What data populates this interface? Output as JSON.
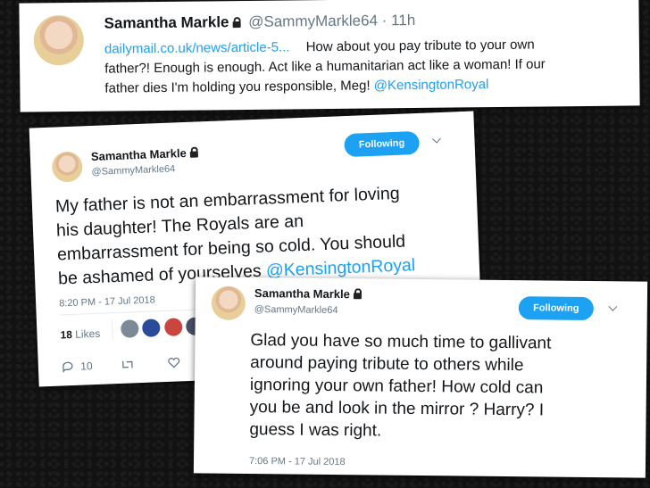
{
  "top_tweet": {
    "name": "Samantha Markle",
    "handle": "@SammyMarkle64",
    "time": "11h",
    "separator": "·",
    "link": "dailymail.co.uk/news/article-5...",
    "text_line1": "How about you pay tribute to your own",
    "text_line2": "father?! Enough is enough. Act like a humanitarian act like a woman! If our",
    "text_line3": "father dies I'm holding you responsible, Meg!",
    "mention": "@KensingtonRoyal"
  },
  "tweet2": {
    "name": "Samantha Markle",
    "handle": "@SammyMarkle64",
    "follow_label": "Following",
    "text_line1": "My father is not an  embarrassment for loving",
    "text_line2": "his daughter! The Royals are an",
    "text_line3": "embarrassment for being so cold. You should",
    "text_line4": "be ashamed of yourselves",
    "mention": "@KensingtonRoyal",
    "timestamp": "8:20 PM - 17 Jul 2018",
    "likes_count": "18",
    "likes_label": "Likes",
    "reply_count": "10"
  },
  "tweet3": {
    "name": "Samantha Markle",
    "handle": "@SammyMarkle64",
    "follow_label": "Following",
    "text_line1": "Glad you have so much time to gallivant",
    "text_line2": "around paying tribute to others while",
    "text_line3": "ignoring your own father! How cold can",
    "text_line4": "you be and look in the mirror ? Harry?  I",
    "text_line5": "guess I was right.",
    "timestamp": "7:06 PM - 17 Jul 2018"
  },
  "colors": {
    "link": "#1da1f2",
    "follow_button": "#1da1f2",
    "background": "#121212"
  },
  "icons": [
    "lock-icon",
    "chevron-down-icon",
    "reply-icon",
    "retweet-icon",
    "like-icon"
  ]
}
